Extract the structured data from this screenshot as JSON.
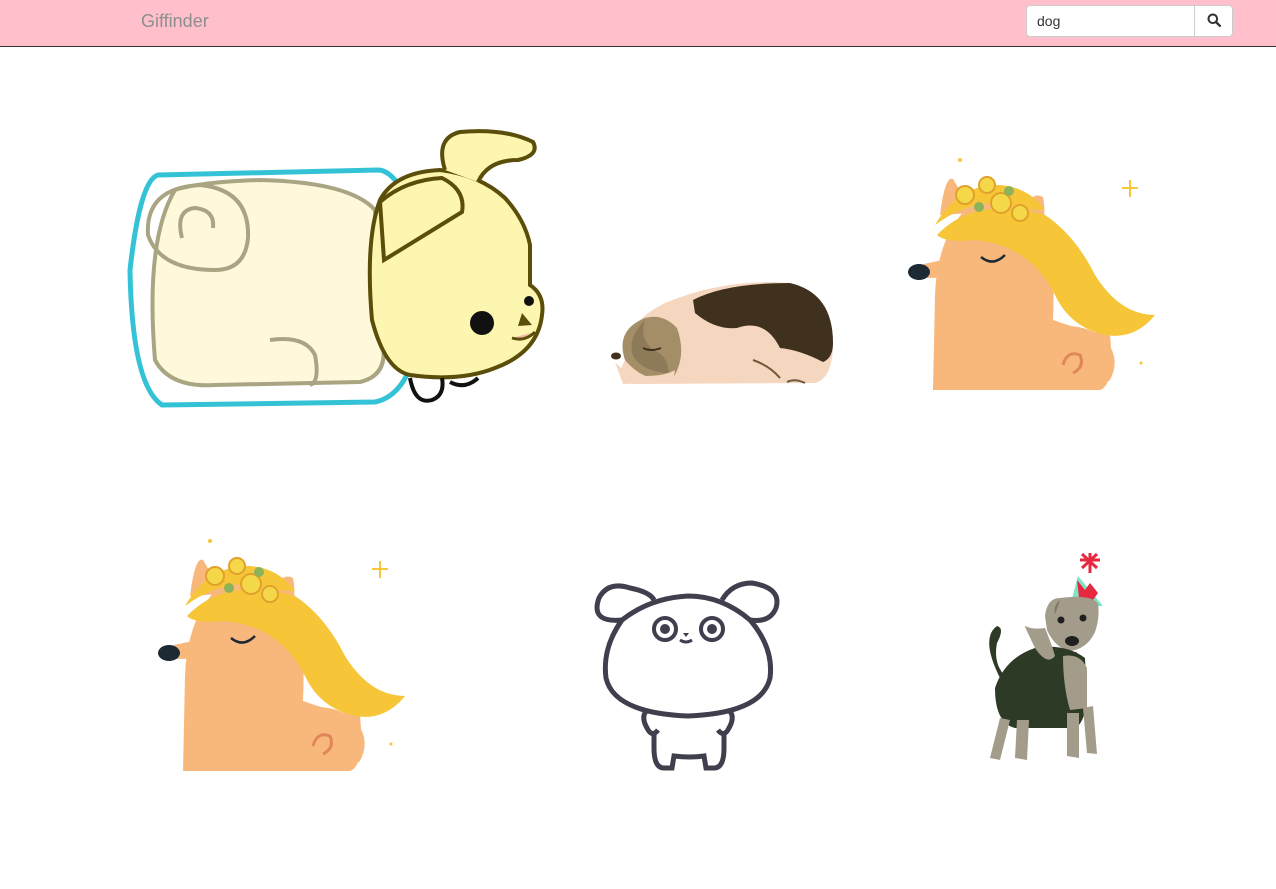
{
  "navbar": {
    "brand": "Giffinder",
    "background": "#ffc0cb",
    "search": {
      "value": "dog",
      "button_icon": "search-icon"
    }
  },
  "results": [
    {
      "name": "yellow-puppy-in-jar"
    },
    {
      "name": "sleeping-beagle"
    },
    {
      "name": "shiba-flower-crown"
    },
    {
      "name": "shiba-flower-crown"
    },
    {
      "name": "outlined-white-puppy"
    },
    {
      "name": "terrier-party-hat"
    }
  ]
}
